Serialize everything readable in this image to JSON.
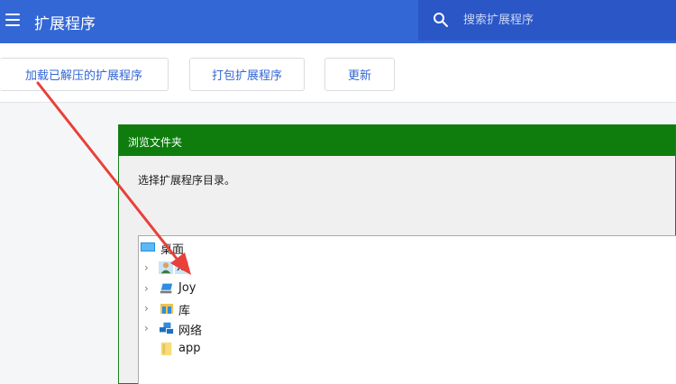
{
  "header": {
    "title": "扩展程序",
    "search_placeholder": "搜索扩展程序",
    "color": "#3367d6"
  },
  "toolbar": {
    "load_unpacked_label": "加载已解压的扩展程序",
    "pack_label": "打包扩展程序",
    "update_label": "更新"
  },
  "dialog": {
    "title": "浏览文件夹",
    "prompt": "选择扩展程序目录。",
    "titlebar_color": "#0e7d0e",
    "tree": [
      {
        "label": "桌面",
        "icon": "desktop-icon",
        "expandable": false
      },
      {
        "label": "xi",
        "icon": "user-icon",
        "expandable": true
      },
      {
        "label": "Joy",
        "icon": "computer-icon",
        "expandable": true
      },
      {
        "label": "库",
        "icon": "library-icon",
        "expandable": true
      },
      {
        "label": "网络",
        "icon": "network-icon",
        "expandable": true
      },
      {
        "label": "app",
        "icon": "folder-icon",
        "expandable": false
      }
    ]
  },
  "annotation": {
    "color": "#e8413a"
  }
}
